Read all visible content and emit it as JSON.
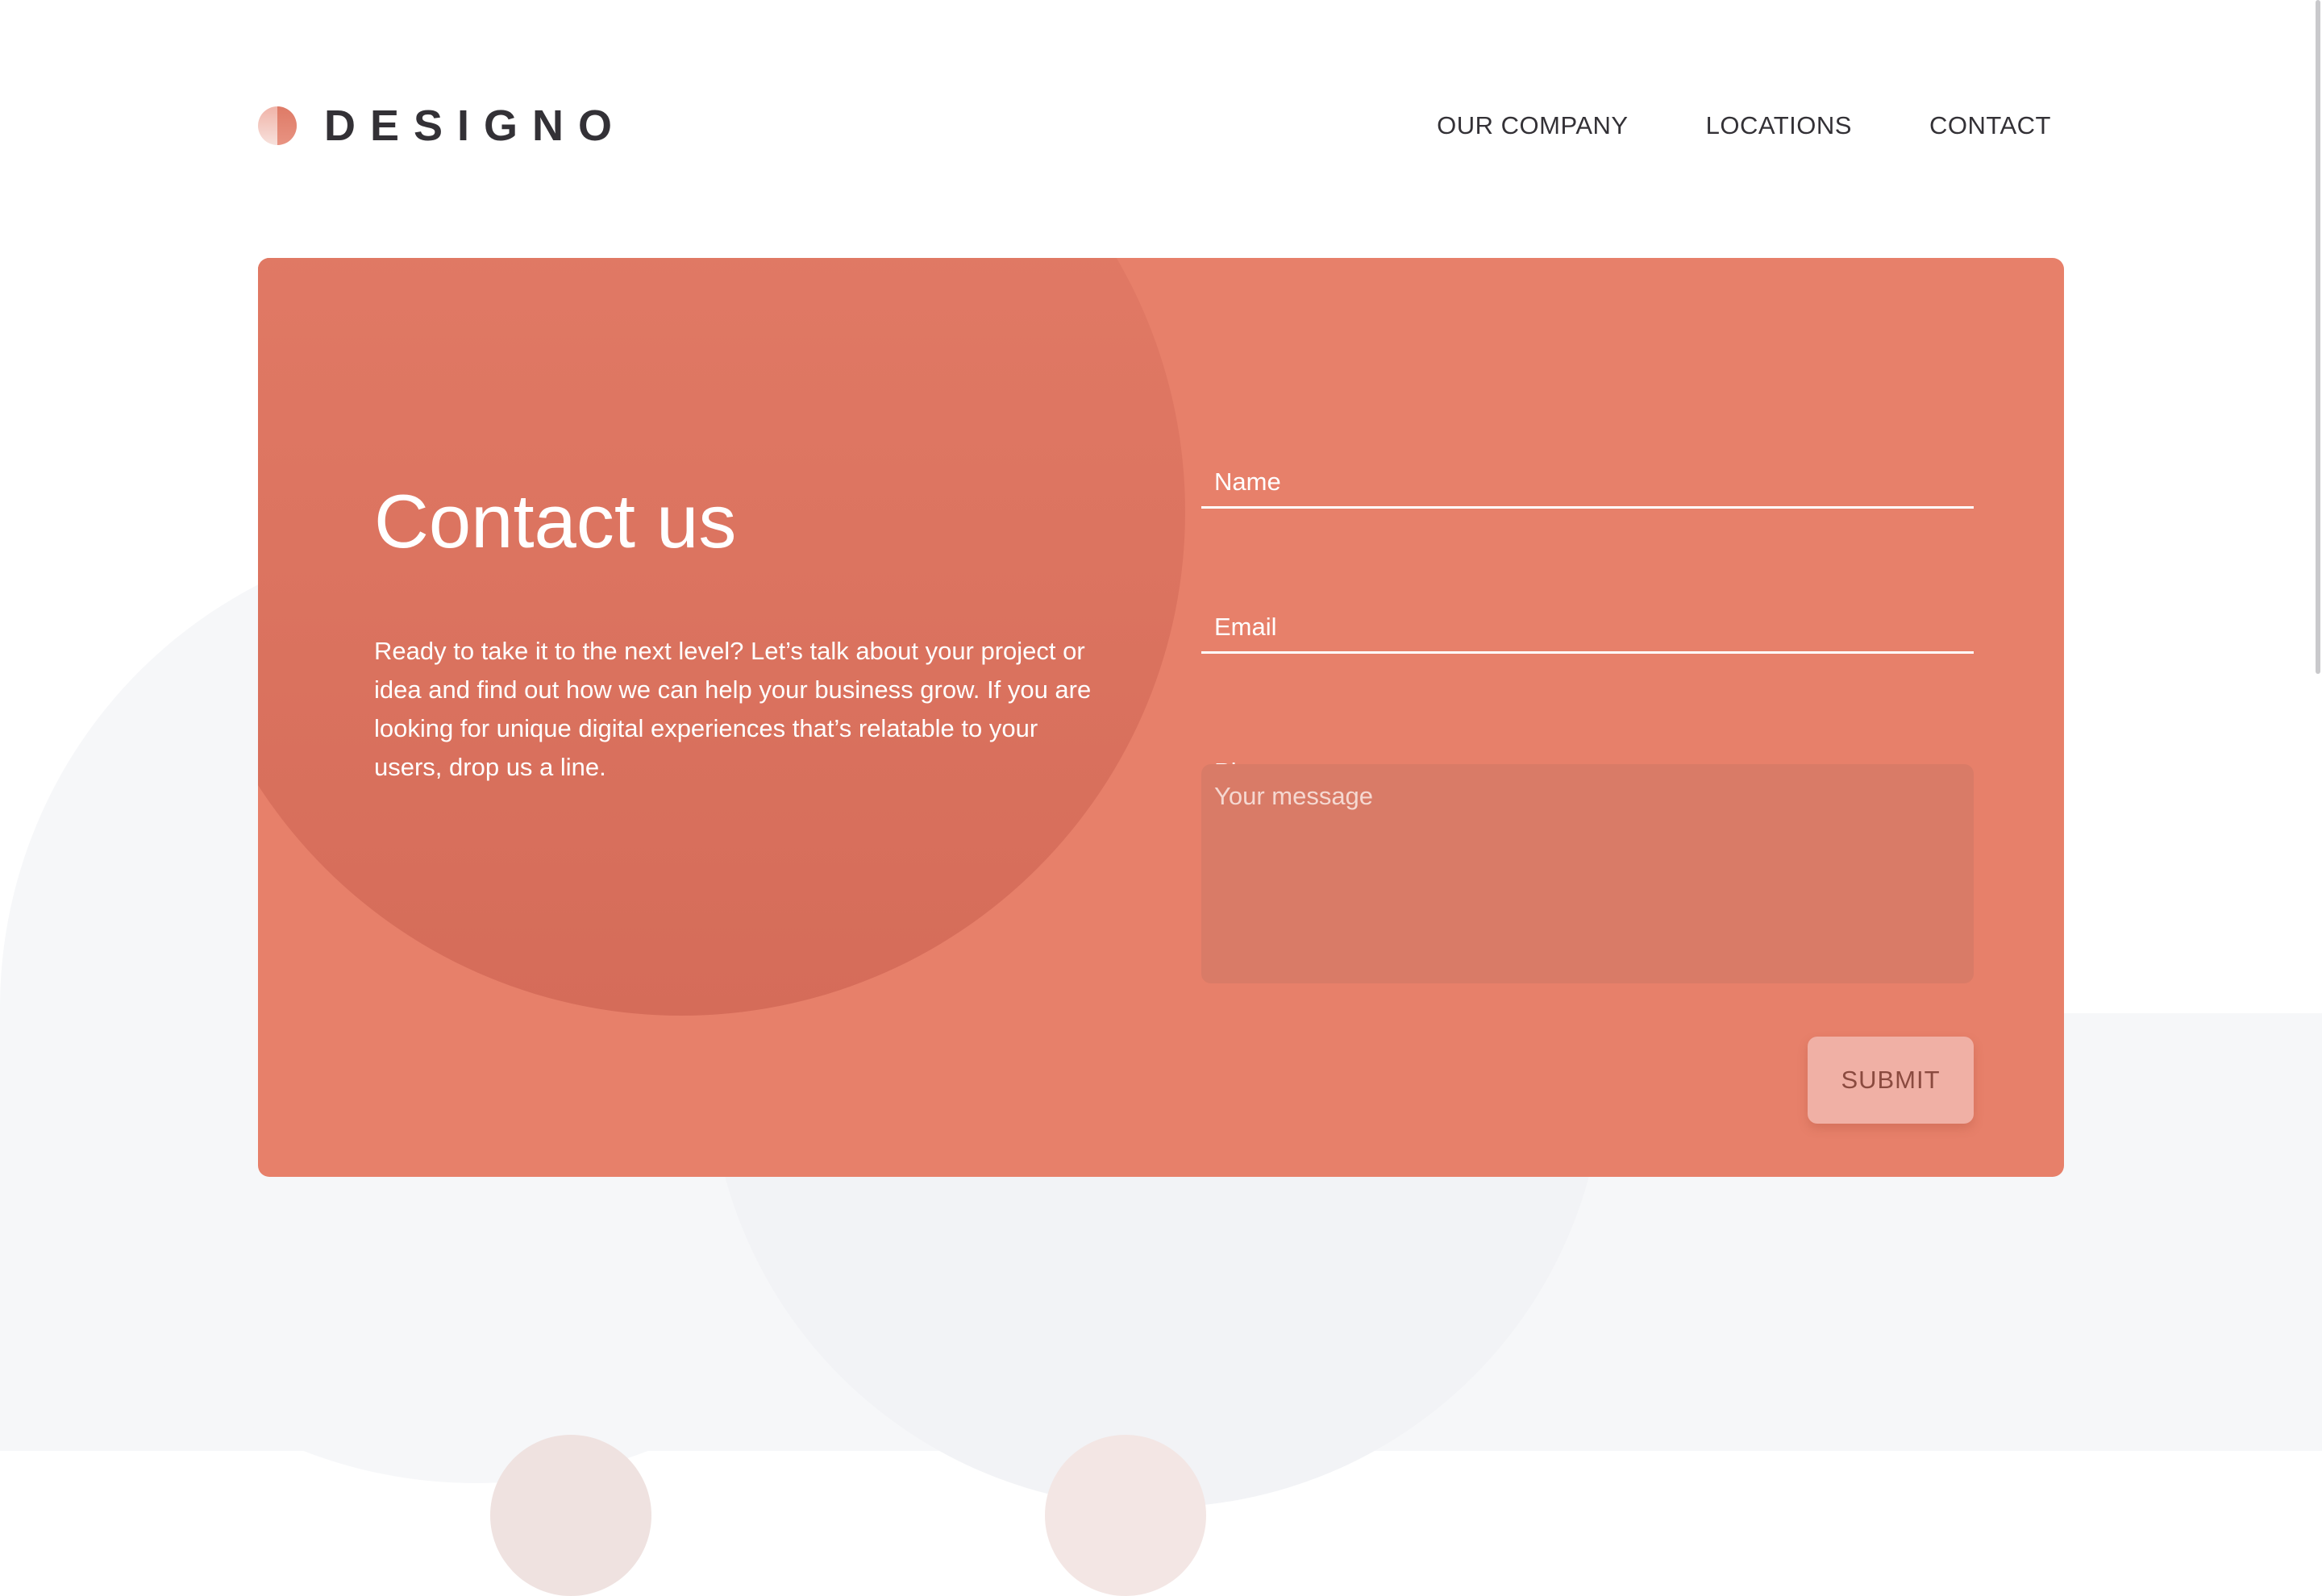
{
  "brand": {
    "name": "DESIGNO",
    "logo_icon": "logo-mark-icon"
  },
  "nav": {
    "items": [
      {
        "label": "OUR COMPANY"
      },
      {
        "label": "LOCATIONS"
      },
      {
        "label": "CONTACT"
      }
    ]
  },
  "contact": {
    "heading": "Contact us",
    "intro": "Ready to take it to the next level? Let’s talk about your project or idea and find out how we can help your business grow. If you are looking for unique digital experiences that’s relatable to your users, drop us a line."
  },
  "form": {
    "name_placeholder": "Name",
    "email_placeholder": "Email",
    "phone_placeholder": "Phone",
    "message_placeholder": "Your message",
    "submit_label": "SUBMIT"
  },
  "colors": {
    "accent": "#e7806a",
    "accent_dark": "#d56c59",
    "button": "#f0b0a5",
    "text_dark": "#333136",
    "background_light": "#f6f7f9"
  }
}
